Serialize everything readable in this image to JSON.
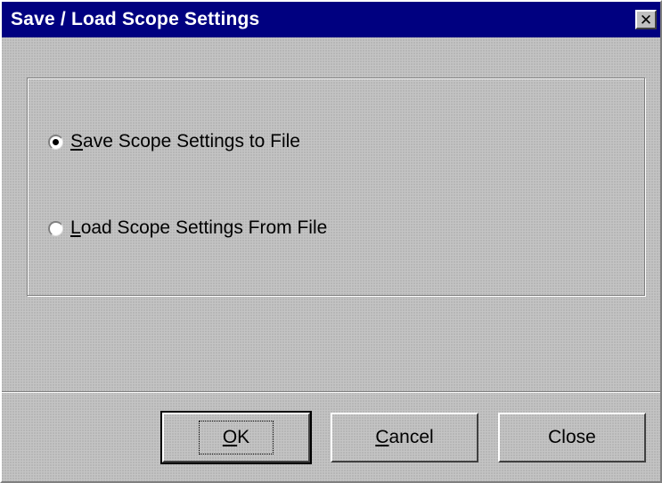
{
  "window": {
    "title": "Save / Load Scope Settings",
    "close_icon": "close-icon"
  },
  "options": [
    {
      "label_accel": "S",
      "label_rest": "ave Scope Settings to File",
      "checked": true
    },
    {
      "label_accel": "L",
      "label_rest": "oad Scope Settings From File",
      "checked": false
    }
  ],
  "buttons": {
    "ok": {
      "accel": "O",
      "rest": "K"
    },
    "cancel": {
      "accel": "C",
      "rest": "ancel"
    },
    "close": {
      "label": "Close"
    }
  },
  "colors": {
    "titlebar": "#000080",
    "face": "#c0c0c0"
  }
}
